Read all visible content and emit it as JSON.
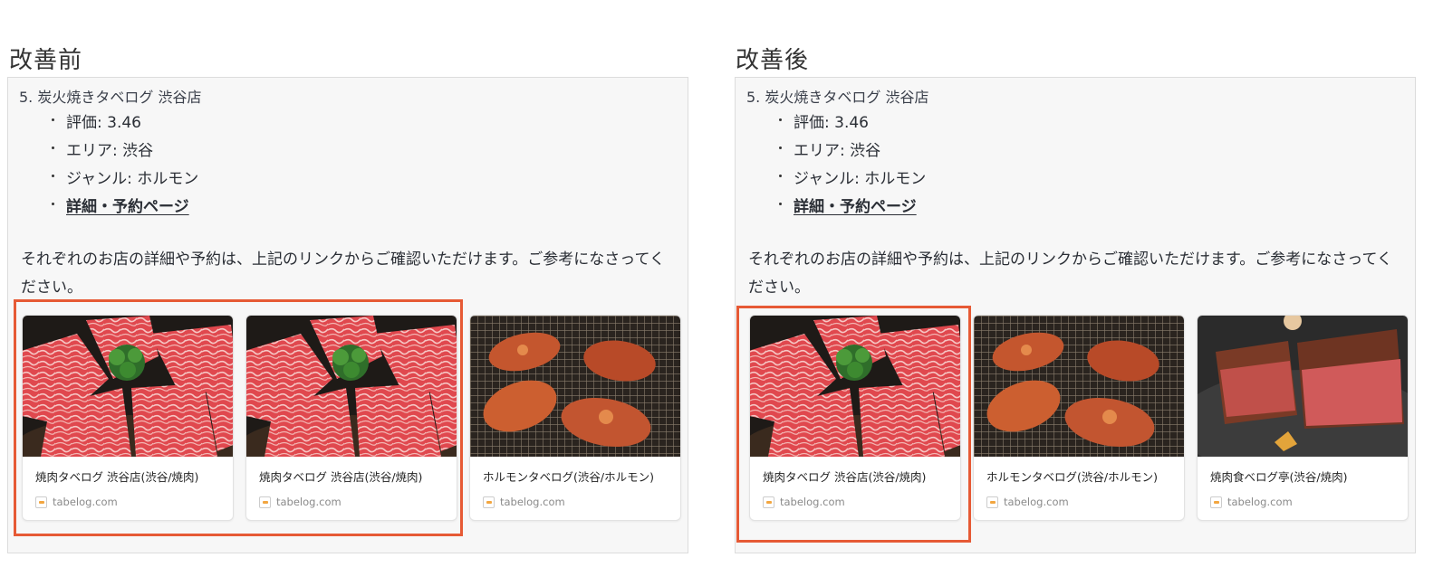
{
  "panels": [
    {
      "label": "改善前",
      "item_title": "5.  炭火焼きタベログ 渋谷店",
      "bullets": [
        "評価: 3.46",
        "エリア: 渋谷",
        "ジャンル: ホルモン"
      ],
      "link_label": "詳細・予約ページ",
      "paragraph": "それぞれのお店の詳細や予約は、上記のリンクからご確認いただけます。ご参考になさってください。",
      "cards": [
        {
          "title": "焼肉タベログ 渋谷店(渋谷/焼肉)",
          "source": "tabelog.com",
          "image": "wagyu-plate"
        },
        {
          "title": "焼肉タベログ 渋谷店(渋谷/焼肉)",
          "source": "tabelog.com",
          "image": "wagyu-plate"
        },
        {
          "title": "ホルモンタベログ(渋谷/ホルモン)",
          "source": "tabelog.com",
          "image": "horumon-grill"
        }
      ],
      "highlight_color": "#e65a35"
    },
    {
      "label": "改善後",
      "item_title": "5.  炭火焼きタベログ 渋谷店",
      "bullets": [
        "評価: 3.46",
        "エリア: 渋谷",
        "ジャンル: ホルモン"
      ],
      "link_label": "詳細・予約ページ",
      "paragraph": "それぞれのお店の詳細や予約は、上記のリンクからご確認いただけます。ご参考になさってください。",
      "cards": [
        {
          "title": "焼肉タベログ 渋谷店(渋谷/焼肉)",
          "source": "tabelog.com",
          "image": "wagyu-plate"
        },
        {
          "title": "ホルモンタベログ(渋谷/ホルモン)",
          "source": "tabelog.com",
          "image": "horumon-grill"
        },
        {
          "title": "焼肉食べログ亭(渋谷/焼肉)",
          "source": "tabelog.com",
          "image": "steak-cut"
        }
      ],
      "highlight_color": "#e65a35"
    }
  ]
}
